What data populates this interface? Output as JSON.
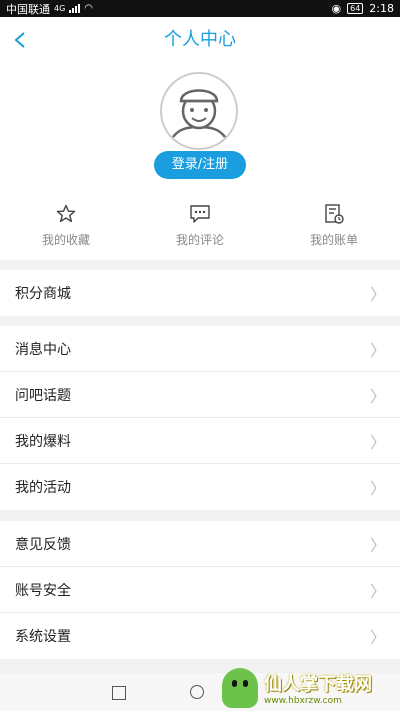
{
  "status_bar": {
    "carrier": "中国联通",
    "network": "4G",
    "battery": "64",
    "time": "2:18"
  },
  "header": {
    "title": "个人中心",
    "back_icon": "chevron-left-icon"
  },
  "profile": {
    "login_label": "登录/注册",
    "avatar_icon": "user-avatar-icon"
  },
  "quick_actions": [
    {
      "label": "我的收藏",
      "icon": "star-icon"
    },
    {
      "label": "我的评论",
      "icon": "comment-icon"
    },
    {
      "label": "我的账单",
      "icon": "bill-icon"
    }
  ],
  "menu_groups": [
    [
      "积分商城"
    ],
    [
      "消息中心",
      "问吧话题",
      "我的爆料",
      "我的活动"
    ],
    [
      "意见反馈",
      "账号安全",
      "系统设置"
    ]
  ],
  "watermark": {
    "title": "仙人掌下载网",
    "url": "www.hbxrzw.com"
  },
  "colors": {
    "accent": "#1a9ee0",
    "background": "#f2f2f2"
  }
}
